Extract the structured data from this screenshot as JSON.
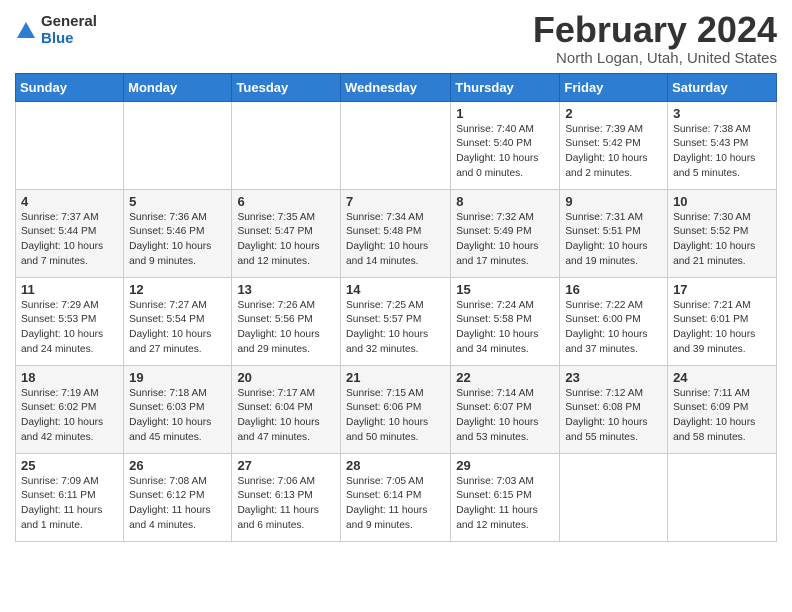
{
  "header": {
    "logo_general": "General",
    "logo_blue": "Blue",
    "month_title": "February 2024",
    "location": "North Logan, Utah, United States"
  },
  "weekdays": [
    "Sunday",
    "Monday",
    "Tuesday",
    "Wednesday",
    "Thursday",
    "Friday",
    "Saturday"
  ],
  "weeks": [
    [
      {
        "day": "",
        "info": ""
      },
      {
        "day": "",
        "info": ""
      },
      {
        "day": "",
        "info": ""
      },
      {
        "day": "",
        "info": ""
      },
      {
        "day": "1",
        "info": "Sunrise: 7:40 AM\nSunset: 5:40 PM\nDaylight: 10 hours\nand 0 minutes."
      },
      {
        "day": "2",
        "info": "Sunrise: 7:39 AM\nSunset: 5:42 PM\nDaylight: 10 hours\nand 2 minutes."
      },
      {
        "day": "3",
        "info": "Sunrise: 7:38 AM\nSunset: 5:43 PM\nDaylight: 10 hours\nand 5 minutes."
      }
    ],
    [
      {
        "day": "4",
        "info": "Sunrise: 7:37 AM\nSunset: 5:44 PM\nDaylight: 10 hours\nand 7 minutes."
      },
      {
        "day": "5",
        "info": "Sunrise: 7:36 AM\nSunset: 5:46 PM\nDaylight: 10 hours\nand 9 minutes."
      },
      {
        "day": "6",
        "info": "Sunrise: 7:35 AM\nSunset: 5:47 PM\nDaylight: 10 hours\nand 12 minutes."
      },
      {
        "day": "7",
        "info": "Sunrise: 7:34 AM\nSunset: 5:48 PM\nDaylight: 10 hours\nand 14 minutes."
      },
      {
        "day": "8",
        "info": "Sunrise: 7:32 AM\nSunset: 5:49 PM\nDaylight: 10 hours\nand 17 minutes."
      },
      {
        "day": "9",
        "info": "Sunrise: 7:31 AM\nSunset: 5:51 PM\nDaylight: 10 hours\nand 19 minutes."
      },
      {
        "day": "10",
        "info": "Sunrise: 7:30 AM\nSunset: 5:52 PM\nDaylight: 10 hours\nand 21 minutes."
      }
    ],
    [
      {
        "day": "11",
        "info": "Sunrise: 7:29 AM\nSunset: 5:53 PM\nDaylight: 10 hours\nand 24 minutes."
      },
      {
        "day": "12",
        "info": "Sunrise: 7:27 AM\nSunset: 5:54 PM\nDaylight: 10 hours\nand 27 minutes."
      },
      {
        "day": "13",
        "info": "Sunrise: 7:26 AM\nSunset: 5:56 PM\nDaylight: 10 hours\nand 29 minutes."
      },
      {
        "day": "14",
        "info": "Sunrise: 7:25 AM\nSunset: 5:57 PM\nDaylight: 10 hours\nand 32 minutes."
      },
      {
        "day": "15",
        "info": "Sunrise: 7:24 AM\nSunset: 5:58 PM\nDaylight: 10 hours\nand 34 minutes."
      },
      {
        "day": "16",
        "info": "Sunrise: 7:22 AM\nSunset: 6:00 PM\nDaylight: 10 hours\nand 37 minutes."
      },
      {
        "day": "17",
        "info": "Sunrise: 7:21 AM\nSunset: 6:01 PM\nDaylight: 10 hours\nand 39 minutes."
      }
    ],
    [
      {
        "day": "18",
        "info": "Sunrise: 7:19 AM\nSunset: 6:02 PM\nDaylight: 10 hours\nand 42 minutes."
      },
      {
        "day": "19",
        "info": "Sunrise: 7:18 AM\nSunset: 6:03 PM\nDaylight: 10 hours\nand 45 minutes."
      },
      {
        "day": "20",
        "info": "Sunrise: 7:17 AM\nSunset: 6:04 PM\nDaylight: 10 hours\nand 47 minutes."
      },
      {
        "day": "21",
        "info": "Sunrise: 7:15 AM\nSunset: 6:06 PM\nDaylight: 10 hours\nand 50 minutes."
      },
      {
        "day": "22",
        "info": "Sunrise: 7:14 AM\nSunset: 6:07 PM\nDaylight: 10 hours\nand 53 minutes."
      },
      {
        "day": "23",
        "info": "Sunrise: 7:12 AM\nSunset: 6:08 PM\nDaylight: 10 hours\nand 55 minutes."
      },
      {
        "day": "24",
        "info": "Sunrise: 7:11 AM\nSunset: 6:09 PM\nDaylight: 10 hours\nand 58 minutes."
      }
    ],
    [
      {
        "day": "25",
        "info": "Sunrise: 7:09 AM\nSunset: 6:11 PM\nDaylight: 11 hours\nand 1 minute."
      },
      {
        "day": "26",
        "info": "Sunrise: 7:08 AM\nSunset: 6:12 PM\nDaylight: 11 hours\nand 4 minutes."
      },
      {
        "day": "27",
        "info": "Sunrise: 7:06 AM\nSunset: 6:13 PM\nDaylight: 11 hours\nand 6 minutes."
      },
      {
        "day": "28",
        "info": "Sunrise: 7:05 AM\nSunset: 6:14 PM\nDaylight: 11 hours\nand 9 minutes."
      },
      {
        "day": "29",
        "info": "Sunrise: 7:03 AM\nSunset: 6:15 PM\nDaylight: 11 hours\nand 12 minutes."
      },
      {
        "day": "",
        "info": ""
      },
      {
        "day": "",
        "info": ""
      }
    ]
  ]
}
